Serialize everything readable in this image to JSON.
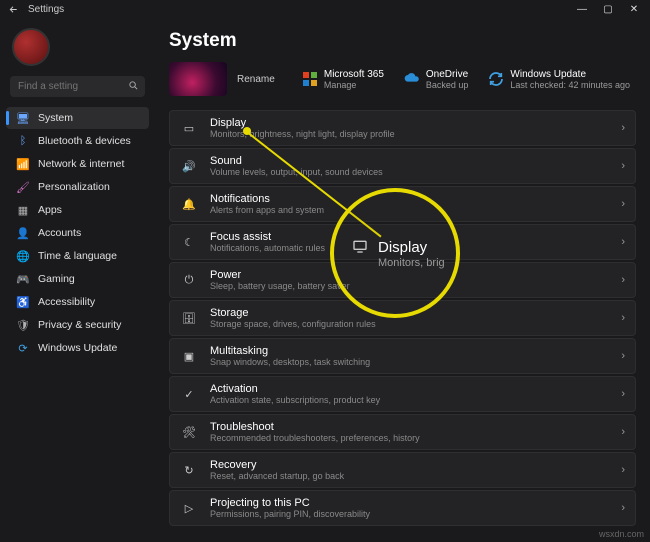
{
  "app": {
    "title": "Settings"
  },
  "search": {
    "placeholder": "Find a setting"
  },
  "sidebar": {
    "items": [
      {
        "label": "System",
        "icon": "🖥",
        "color": "#6aa8ff",
        "selected": true
      },
      {
        "label": "Bluetooth & devices",
        "icon": "ᛒ",
        "color": "#6aa8ff"
      },
      {
        "label": "Network & internet",
        "icon": "📶",
        "color": "#2dc0c8"
      },
      {
        "label": "Personalization",
        "icon": "🖌",
        "color": "#d070c0"
      },
      {
        "label": "Apps",
        "icon": "▦",
        "color": "#b0b0b0"
      },
      {
        "label": "Accounts",
        "icon": "👤",
        "color": "#e09050"
      },
      {
        "label": "Time & language",
        "icon": "🌐",
        "color": "#5ab0f0"
      },
      {
        "label": "Gaming",
        "icon": "🎮",
        "color": "#60c060"
      },
      {
        "label": "Accessibility",
        "icon": "♿",
        "color": "#5a90e0"
      },
      {
        "label": "Privacy & security",
        "icon": "🛡",
        "color": "#b0b0b0"
      },
      {
        "label": "Windows Update",
        "icon": "⟳",
        "color": "#40a0e0"
      }
    ]
  },
  "page": {
    "heading": "System",
    "rename": "Rename",
    "tiles": [
      {
        "title": "Microsoft 365",
        "sub": "Manage",
        "icon": "ms365"
      },
      {
        "title": "OneDrive",
        "sub": "Backed up",
        "icon": "onedrive"
      },
      {
        "title": "Windows Update",
        "sub": "Last checked: 42 minutes ago",
        "icon": "winupdate"
      }
    ],
    "rows": [
      {
        "title": "Display",
        "sub": "Monitors, brightness, night light, display profile",
        "icon": "▭"
      },
      {
        "title": "Sound",
        "sub": "Volume levels, output, input, sound devices",
        "icon": "🔊"
      },
      {
        "title": "Notifications",
        "sub": "Alerts from apps and system",
        "icon": "🔔"
      },
      {
        "title": "Focus assist",
        "sub": "Notifications, automatic rules",
        "icon": "☾"
      },
      {
        "title": "Power",
        "sub": "Sleep, battery usage, battery saver",
        "icon": "⏻"
      },
      {
        "title": "Storage",
        "sub": "Storage space, drives, configuration rules",
        "icon": "🗄"
      },
      {
        "title": "Multitasking",
        "sub": "Snap windows, desktops, task switching",
        "icon": "▣"
      },
      {
        "title": "Activation",
        "sub": "Activation state, subscriptions, product key",
        "icon": "✓"
      },
      {
        "title": "Troubleshoot",
        "sub": "Recommended troubleshooters, preferences, history",
        "icon": "🛠"
      },
      {
        "title": "Recovery",
        "sub": "Reset, advanced startup, go back",
        "icon": "↻"
      },
      {
        "title": "Projecting to this PC",
        "sub": "Permissions, pairing PIN, discoverability",
        "icon": "▷"
      }
    ]
  },
  "callout": {
    "title": "Display",
    "sub": "Monitors, brig"
  },
  "watermark": "wsxdn.com"
}
